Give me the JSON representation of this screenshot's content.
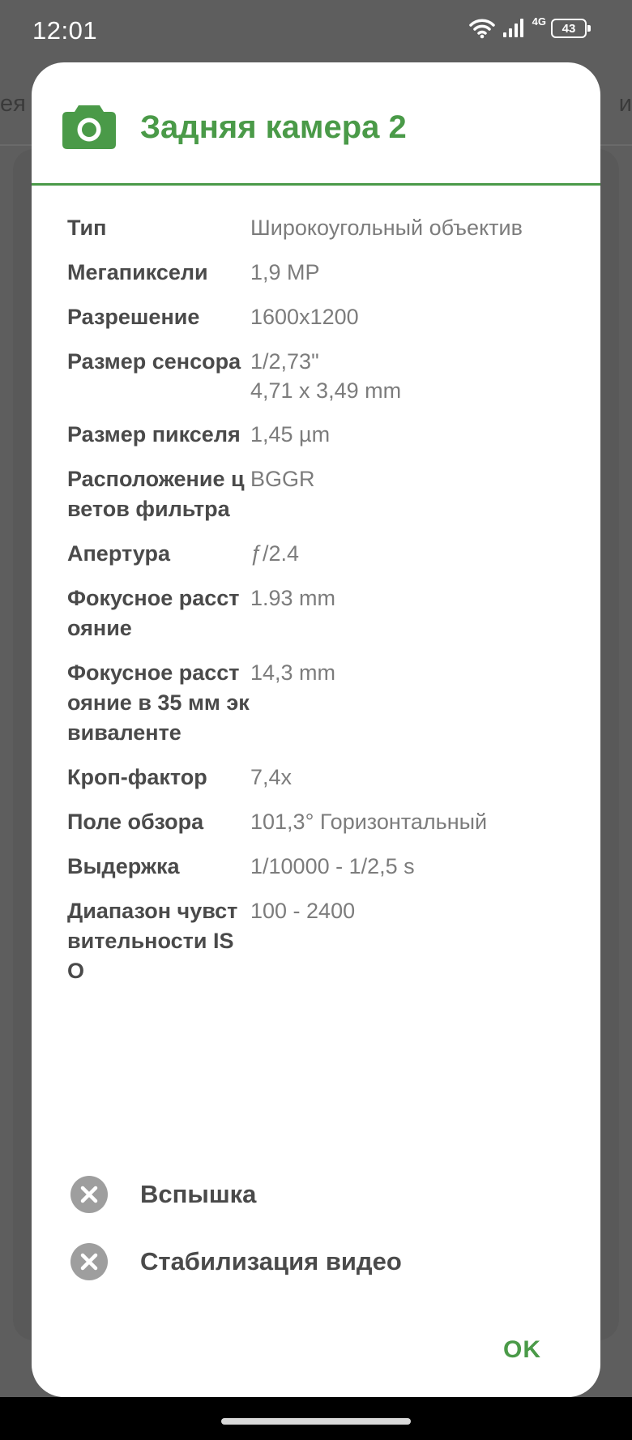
{
  "status_bar": {
    "time": "12:01",
    "network": "4G",
    "battery": "43",
    "icons": [
      "wifi-icon",
      "signal-icon",
      "battery-icon"
    ]
  },
  "background": {
    "tab_left_fragment": "ея",
    "tab_right_fragment": "и"
  },
  "dialog": {
    "title": "Задняя камера 2",
    "icon": "camera-icon",
    "accent_color": "#4a9a48",
    "properties": [
      {
        "label": "Тип",
        "value": "Широкоугольный объектив"
      },
      {
        "label": "Мегапиксели",
        "value": "1,9 MP"
      },
      {
        "label": "Разрешение",
        "value": "1600x1200"
      },
      {
        "label": "Размер сенсора",
        "value": "1/2,73\"\n4,71 x 3,49 mm"
      },
      {
        "label": "Размер пикселя",
        "value": "1,45 µm"
      },
      {
        "label": "Расположение цветов фильтра",
        "value": "BGGR"
      },
      {
        "label": "Апертура",
        "value": "ƒ/2.4"
      },
      {
        "label": "Фокусное расстояние",
        "value": "1.93 mm"
      },
      {
        "label": "Фокусное расстояние в 35 мм эквиваленте",
        "value": "14,3 mm"
      },
      {
        "label": "Кроп-фактор",
        "value": "7,4x"
      },
      {
        "label": "Поле обзора",
        "value": "101,3° Горизонтальный"
      },
      {
        "label": "Выдержка",
        "value": "1/10000 - 1/2,5 s"
      },
      {
        "label": "Диапазон чувствительности ISO",
        "value": "100 - 2400"
      }
    ],
    "features": [
      {
        "label": "Вспышка",
        "supported": false,
        "icon": "x-circle-icon"
      },
      {
        "label": "Стабилизация видео",
        "supported": false,
        "icon": "x-circle-icon"
      }
    ],
    "ok_label": "OK"
  }
}
